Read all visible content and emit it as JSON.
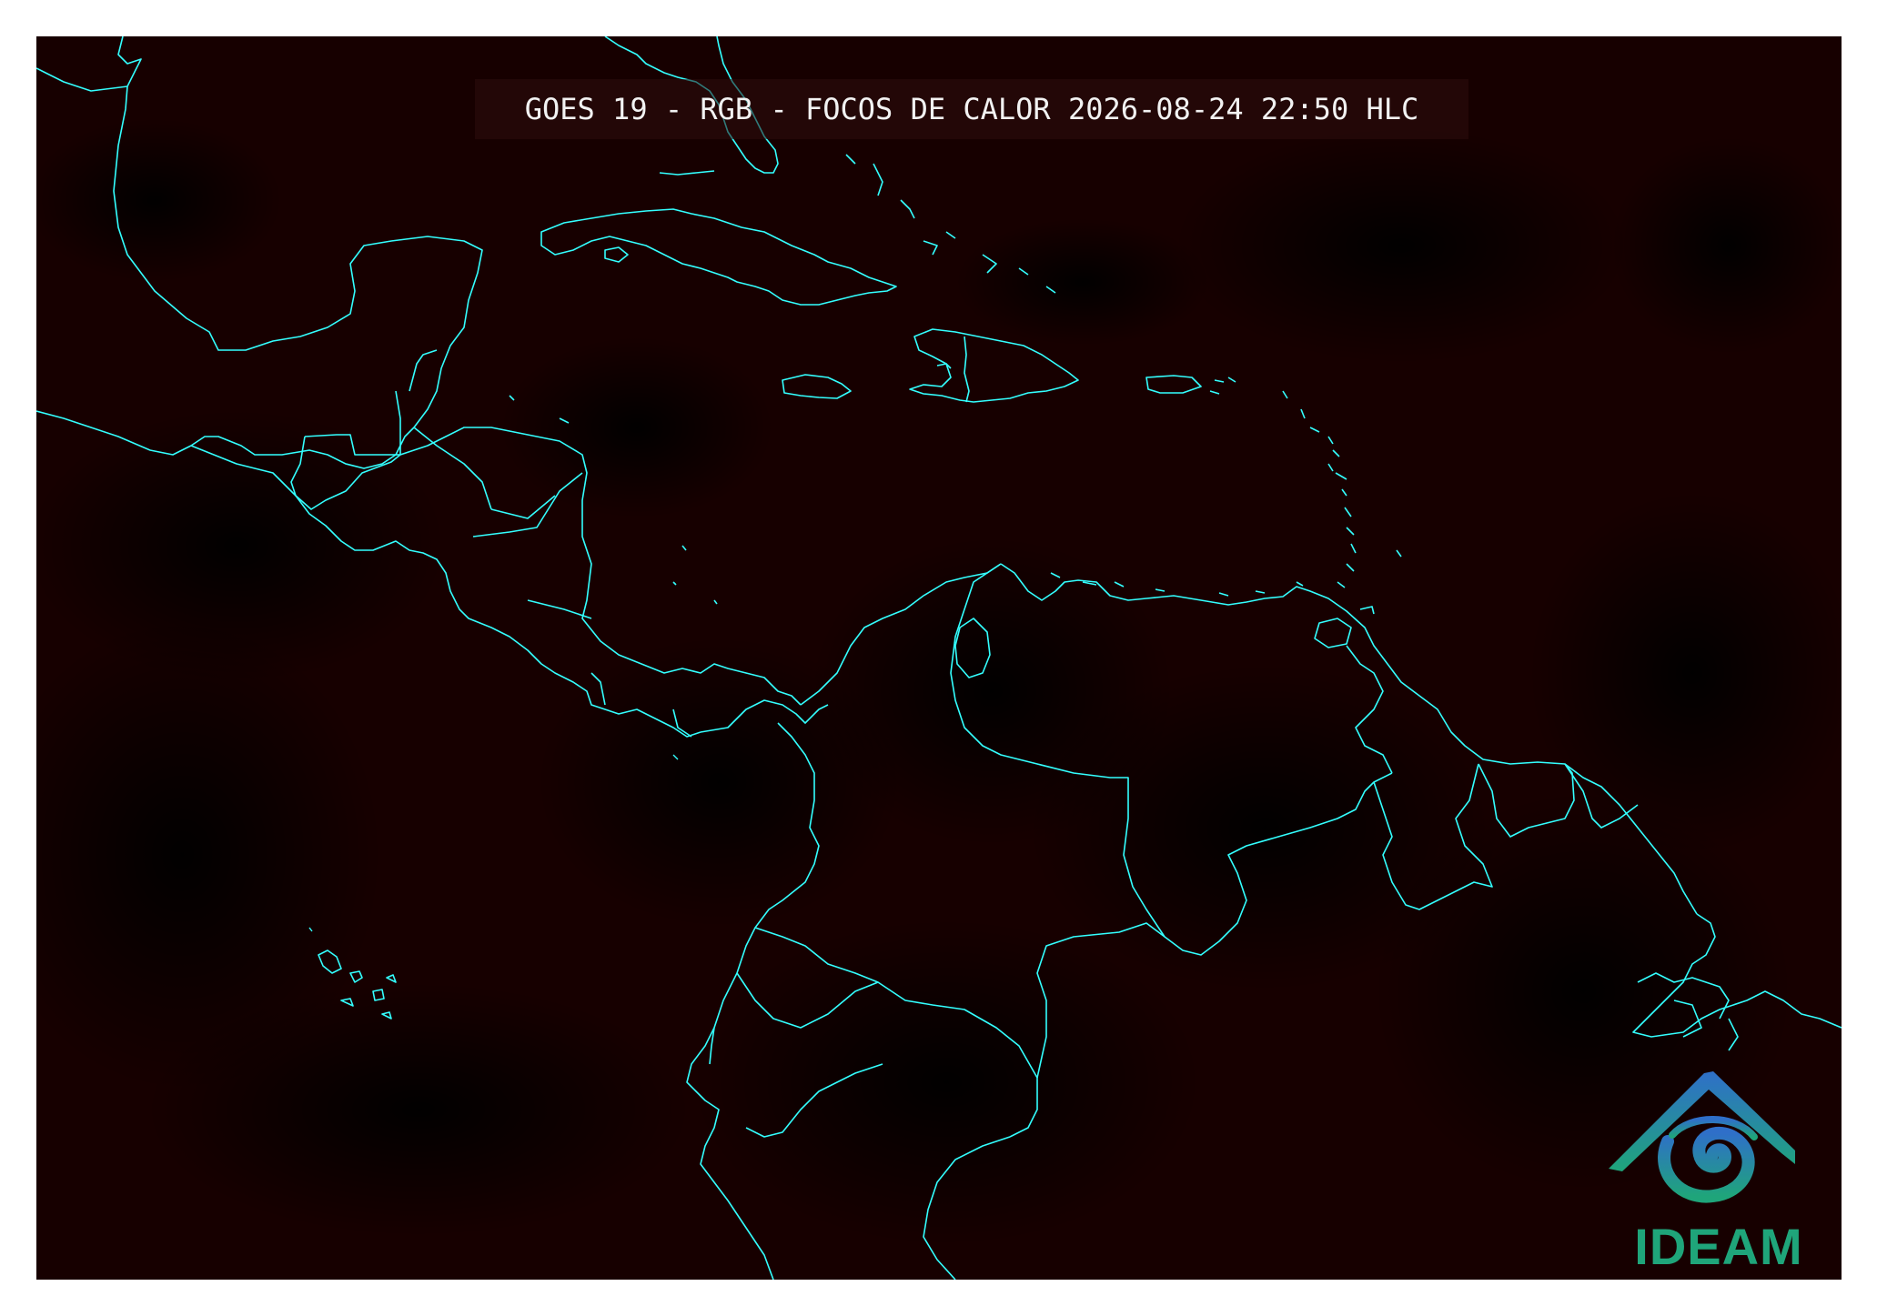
{
  "map": {
    "title": "GOES 19 - RGB - FOCOS DE CALOR 2026-08-24 22:50 HLC",
    "background_color": "#170000",
    "coastline_color": "#33ffff"
  },
  "logo": {
    "text": "IDEAM",
    "icon": "ideam-mountain-swirl-icon",
    "colors": [
      "#2f6fc9",
      "#1fa57a"
    ]
  }
}
